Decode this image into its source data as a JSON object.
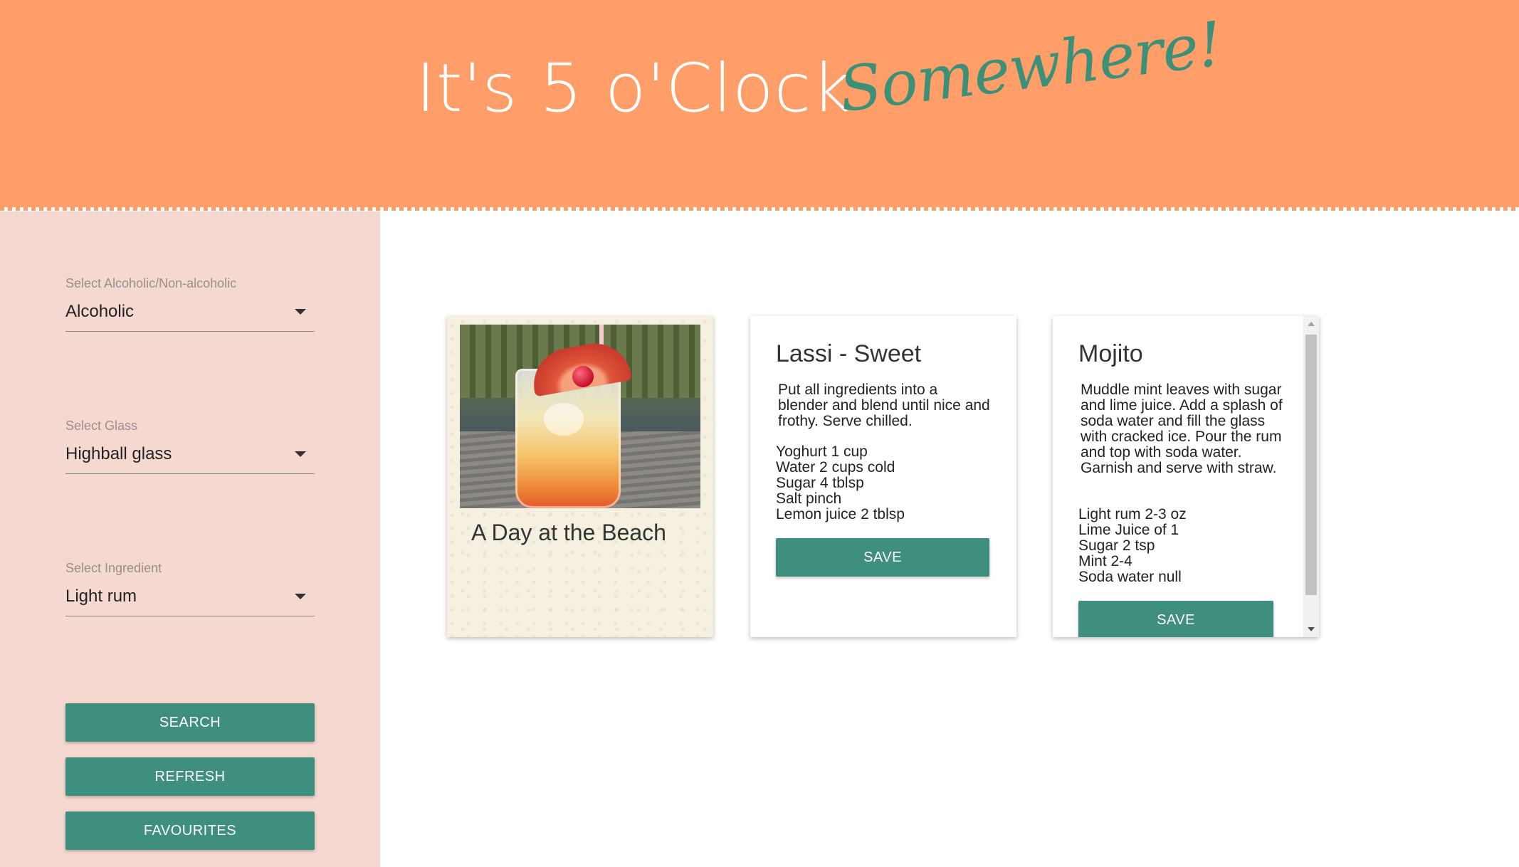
{
  "header": {
    "title_main": "It's 5 o'Clock",
    "title_script": "Somewhere!"
  },
  "sidebar": {
    "filters": [
      {
        "label": "Select Alcoholic/Non-alcoholic",
        "value": "Alcoholic"
      },
      {
        "label": "Select Glass",
        "value": "Highball glass"
      },
      {
        "label": "Select Ingredient",
        "value": "Light rum"
      }
    ],
    "buttons": {
      "search": "SEARCH",
      "refresh": "REFRESH",
      "favourites": "FAVOURITES"
    }
  },
  "cards": {
    "photo_card": {
      "title": "A Day at the Beach"
    },
    "lassi": {
      "title": "Lassi - Sweet",
      "instructions": "Put all ingredients into a blender and blend until nice and frothy. Serve chilled.",
      "ingredients": [
        "Yoghurt 1 cup",
        "Water 2 cups cold",
        "Sugar 4 tblsp",
        "Salt pinch",
        "Lemon juice 2 tblsp"
      ],
      "save_label": "SAVE"
    },
    "mojito": {
      "title": "Mojito",
      "instructions": "Muddle mint leaves with sugar and lime juice. Add a splash of soda water and fill the glass with cracked ice. Pour the rum and top with soda water. Garnish and serve with straw.",
      "ingredients": [
        "Light rum 2-3 oz",
        "Lime Juice of 1",
        "Sugar 2 tsp",
        "Mint 2-4",
        "Soda water null"
      ],
      "save_label": "SAVE"
    }
  },
  "colors": {
    "header_bg": "#FF9E68",
    "sidebar_bg": "#F5D9D1",
    "accent_green": "#3E8F7E",
    "script_green": "#3C9078"
  }
}
